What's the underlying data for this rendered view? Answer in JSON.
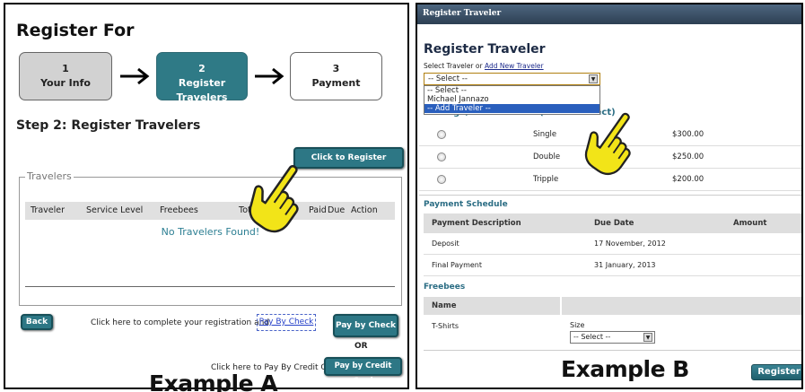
{
  "panel_a": {
    "title": "Register For",
    "steps": [
      {
        "num": "1",
        "label": "Your Info"
      },
      {
        "num": "2",
        "label": "Register Travelers"
      },
      {
        "num": "3",
        "label": "Payment"
      }
    ],
    "step_title": "Step 2: Register Travelers",
    "register_button": "Click to Register Travelers",
    "travelers_legend": "Travelers",
    "columns": [
      "Traveler",
      "Service Level",
      "Freebees",
      "Total T",
      "Paid",
      "Due",
      "Action"
    ],
    "empty_message": "No Travelers Found!",
    "back_button": "Back",
    "complete_text": "Click here to complete your registration and",
    "pay_link": "Pay By Check",
    "pay_check_button": "Pay by Check",
    "or_text": "OR",
    "credit_text": "Click here to Pay By Credit Card",
    "pay_card_button": "Pay by Credit Card",
    "example_label": "Example A"
  },
  "panel_b": {
    "window_title": "Register Traveler",
    "title": "Register Traveler",
    "select_label": "Select Traveler or",
    "add_link": "Add New Traveler",
    "select_value": "-- Select --",
    "dropdown_options": [
      "-- Select --",
      "Michael Jannazo",
      "-- Add Traveler --"
    ],
    "package_heading": "Package/Service Level (Please Select)",
    "packages": [
      {
        "name": "Single",
        "price": "$300.00"
      },
      {
        "name": "Double",
        "price": "$250.00"
      },
      {
        "name": "Tripple",
        "price": "$200.00"
      }
    ],
    "payment_heading": "Payment Schedule",
    "payment_columns": [
      "Payment Description",
      "Due Date",
      "Amount"
    ],
    "payments": [
      {
        "desc": "Deposit",
        "due": "17 November, 2012"
      },
      {
        "desc": "Final Payment",
        "due": "31 January, 2013"
      }
    ],
    "freebees_heading": "Freebees",
    "freebees_column": "Name",
    "freebee_item": "T-Shirts",
    "size_label": "Size",
    "size_value": "-- Select --",
    "example_label": "Example B",
    "register_button": "Register"
  },
  "colors": {
    "teal": "#2d7785",
    "heading": "#2b6d84",
    "hand": "#f2e418"
  }
}
